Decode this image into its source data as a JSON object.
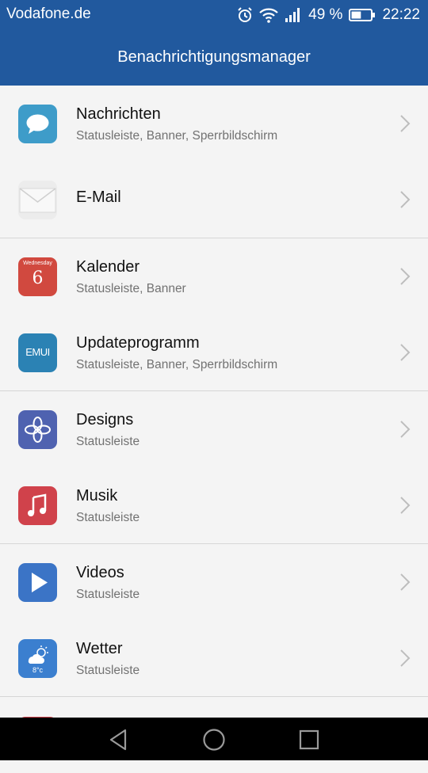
{
  "status_bar": {
    "carrier": "Vodafone.de",
    "battery_percent": "49 %",
    "time": "22:22",
    "battery_level": 0.49,
    "icons": [
      "alarm-icon",
      "wifi-icon",
      "signal-icon",
      "battery-icon"
    ]
  },
  "header": {
    "title": "Benachrichtigungsmanager"
  },
  "apps": [
    {
      "name": "Nachrichten",
      "subtitle": "Statusleiste, Banner, Sperrbildschirm",
      "icon": "messages-icon",
      "color": "#3e9cc9"
    },
    {
      "name": "E-Mail",
      "subtitle": "",
      "icon": "email-icon",
      "color": "#ececec"
    },
    {
      "name": "Kalender",
      "subtitle": "Statusleiste, Banner",
      "icon": "calendar-icon",
      "color": "#d1493f",
      "icon_text_top": "Wednesday",
      "icon_text_day": "6"
    },
    {
      "name": "Updateprogramm",
      "subtitle": "Statusleiste, Banner, Sperrbildschirm",
      "icon": "emui-update-icon",
      "color": "#2b82b4",
      "icon_text": "EMUI"
    },
    {
      "name": "Designs",
      "subtitle": "Statusleiste",
      "icon": "themes-icon",
      "color": "#4f62b0"
    },
    {
      "name": "Musik",
      "subtitle": "Statusleiste",
      "icon": "music-icon",
      "color": "#d0424b"
    },
    {
      "name": "Videos",
      "subtitle": "Statusleiste",
      "icon": "videos-icon",
      "color": "#3b74c6"
    },
    {
      "name": "Wetter",
      "subtitle": "Statusleiste",
      "icon": "weather-icon",
      "color": "#3b7fcf",
      "icon_text": "8°c"
    }
  ],
  "nav": [
    "back-icon",
    "home-icon",
    "recents-icon"
  ]
}
